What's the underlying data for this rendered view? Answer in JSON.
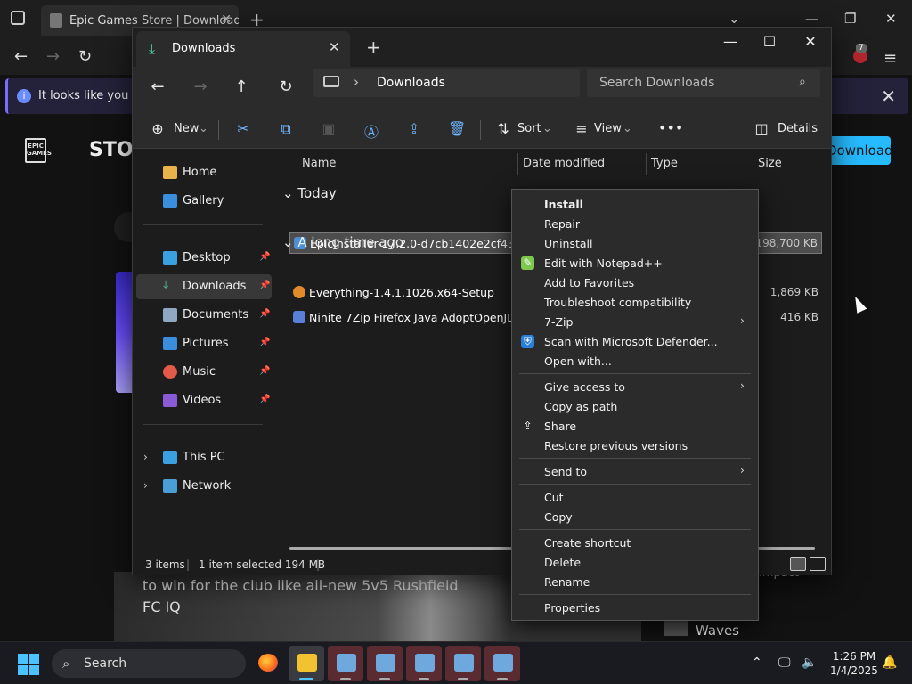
{
  "browser": {
    "tab_title": "Epic Games Store | Download &",
    "notification": "It looks like you have",
    "epic_logo_text": "EPIC GAMES",
    "store_label": "STORE",
    "download_label": "Download",
    "extension_badge": "7",
    "banner_text": "to win for the club like all-new 5v5 Rushfield FC IQ",
    "side_title": "Waves",
    "side_sub": "Impact"
  },
  "explorer": {
    "tab_label": "Downloads",
    "address": "Downloads",
    "search_placeholder": "Search Downloads",
    "commands": {
      "new": "New",
      "sort": "Sort",
      "view": "View",
      "details": "Details"
    },
    "sidebar": [
      {
        "label": "Home",
        "icon": "home-icon"
      },
      {
        "label": "Gallery",
        "icon": "gallery-icon"
      },
      {
        "label": "Desktop",
        "icon": "desktop-icon",
        "pinned": true
      },
      {
        "label": "Downloads",
        "icon": "downloads-icon",
        "pinned": true,
        "selected": true
      },
      {
        "label": "Documents",
        "icon": "documents-icon",
        "pinned": true
      },
      {
        "label": "Pictures",
        "icon": "pictures-icon",
        "pinned": true
      },
      {
        "label": "Music",
        "icon": "music-icon",
        "pinned": true
      },
      {
        "label": "Videos",
        "icon": "videos-icon",
        "pinned": true
      },
      {
        "label": "This PC",
        "icon": "pc-icon"
      },
      {
        "label": "Network",
        "icon": "network-icon"
      }
    ],
    "columns": [
      "Name",
      "Date modified",
      "Type",
      "Size"
    ],
    "groups": [
      {
        "label": "Today",
        "files": [
          {
            "name": "EpicInstaller-17.2.0-d7cb1402e2cf439fb30...",
            "size": "198,700 KB",
            "selected": true
          }
        ]
      },
      {
        "label": "A long time ago",
        "files": [
          {
            "name": "Everything-1.4.1.1026.x64-Setup",
            "size": "1,869 KB"
          },
          {
            "name": "Ninite 7Zip Firefox Java AdoptOpenJDK x...",
            "size": "416 KB"
          }
        ]
      }
    ],
    "status": {
      "items": "3 items",
      "selected": "1 item selected  194 MB"
    }
  },
  "context_menu": {
    "groups": [
      [
        "Install",
        "Repair",
        "Uninstall",
        "Edit with Notepad++",
        "Add to Favorites",
        "Troubleshoot compatibility",
        "7-Zip",
        "Scan with Microsoft Defender...",
        "Open with..."
      ],
      [
        "Give access to",
        "Copy as path",
        "Share",
        "Restore previous versions"
      ],
      [
        "Send to"
      ],
      [
        "Cut",
        "Copy"
      ],
      [
        "Create shortcut",
        "Delete",
        "Rename"
      ],
      [
        "Properties"
      ]
    ]
  },
  "taskbar": {
    "search_label": "Search",
    "time": "1:26 PM",
    "date": "1/4/2025"
  },
  "colors": {
    "accent": "#4cc2ff",
    "epic_download": "#26bbff"
  }
}
